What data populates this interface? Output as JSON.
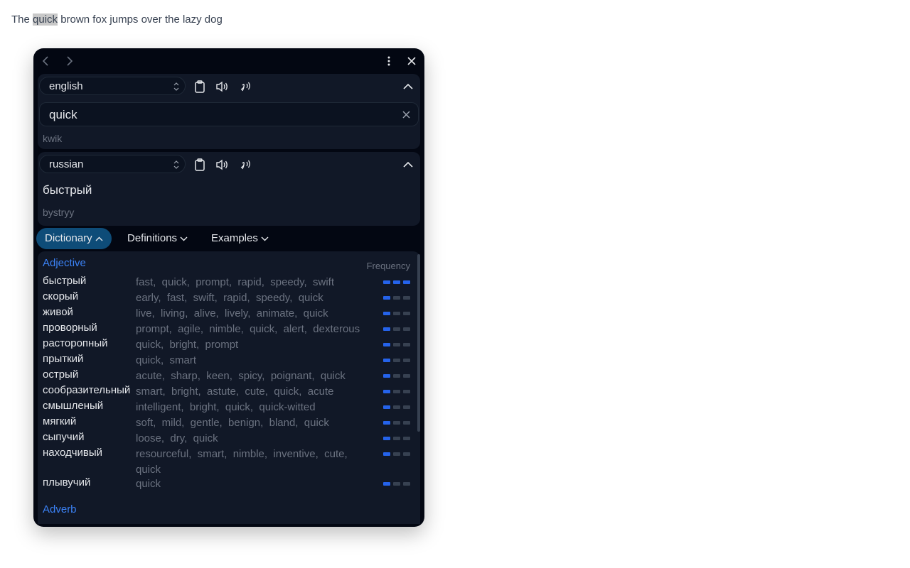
{
  "page": {
    "sentence_before": "The ",
    "highlighted_word": "quick",
    "sentence_after": " brown fox jumps over the lazy dog"
  },
  "popup": {
    "source": {
      "language": "english",
      "text": "quick",
      "transliteration": "kwik"
    },
    "target": {
      "language": "russian",
      "text": "быстрый",
      "transliteration": "bystryy"
    },
    "tabs": [
      {
        "label": "Dictionary",
        "active": true
      },
      {
        "label": "Definitions",
        "active": false
      },
      {
        "label": "Examples",
        "active": false
      }
    ],
    "dictionary": {
      "frequency_label": "Frequency",
      "sections": [
        {
          "pos": "Adjective",
          "entries": [
            {
              "word": "быстрый",
              "synonyms": "fast,  quick,  prompt,  rapid,  speedy,  swift",
              "frequency": 3
            },
            {
              "word": "скорый",
              "synonyms": "early,  fast,  swift,  rapid,  speedy,  quick",
              "frequency": 1
            },
            {
              "word": "живой",
              "synonyms": "live,  living,  alive,  lively,  animate,  quick",
              "frequency": 1
            },
            {
              "word": "проворный",
              "synonyms": "prompt,  agile,  nimble,  quick,  alert,  dexterous",
              "frequency": 1
            },
            {
              "word": "расторопный",
              "synonyms": "quick,  bright,  prompt",
              "frequency": 1
            },
            {
              "word": "прыткий",
              "synonyms": "quick,  smart",
              "frequency": 1
            },
            {
              "word": "острый",
              "synonyms": "acute,  sharp,  keen,  spicy,  poignant,  quick",
              "frequency": 1
            },
            {
              "word": "сообразительный",
              "synonyms": "smart,  bright,  astute,  cute,  quick,  acute",
              "frequency": 1
            },
            {
              "word": "смышленый",
              "synonyms": "intelligent,  bright,  quick,  quick-witted",
              "frequency": 1
            },
            {
              "word": "мягкий",
              "synonyms": "soft,  mild,  gentle,  benign,  bland,  quick",
              "frequency": 1
            },
            {
              "word": "сыпучий",
              "synonyms": "loose,  dry,  quick",
              "frequency": 1
            },
            {
              "word": "находчивый",
              "synonyms": "resourceful,  smart,  nimble,  inventive,  cute,  quick",
              "frequency": 1
            },
            {
              "word": "плывучий",
              "synonyms": "quick",
              "frequency": 1
            }
          ]
        },
        {
          "pos": "Adverb",
          "entries": []
        }
      ]
    }
  },
  "colors": {
    "accent": "#3b82f6",
    "freq_on": "#2563eb",
    "freq_off": "#374151",
    "active_tab": "#0e4c78"
  }
}
